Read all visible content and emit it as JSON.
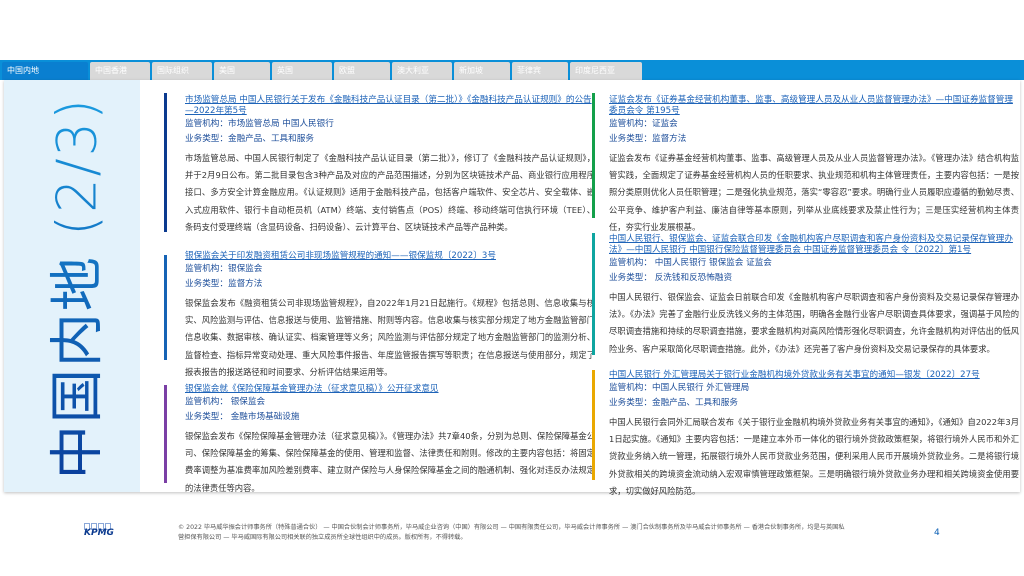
{
  "tabs": [
    "中国内地",
    "中国香港",
    "国际组织",
    "美国",
    "英国",
    "欧盟",
    "澳大利亚",
    "新加坡",
    "菲律宾",
    "印度尼西亚"
  ],
  "side_title": "中国内地 (2/3)",
  "colors": {
    "bar1": "#0b3a8f",
    "bar2": "#1563b5",
    "bar3": "#7a3fa5",
    "bar4": "#13a04a",
    "bar5": "#0ea5a0",
    "bar6": "#eaa800"
  },
  "items": [
    {
      "title": "市场监管总局 中国人民银行关于发布《金融科技产品认证目录（第二批）》《金融科技产品认证规则》的公告—2022年第5号",
      "agency": "监管机构：市场监管总局 中国人民银行",
      "type": "业务类型：金融产品、工具和服务",
      "body": "市场监管总局、中国人民银行制定了《金融科技产品认证目录（第二批）》，修订了《金融科技产品认证规则》，并于2月9日公布。第二批目录包含3种产品及对应的产品范围描述，分别为区块链技术产品、商业银行应用程序接口、多方安全计算金融应用。《认证规则》适用于金融科技产品，包括客户端软件、安全芯片、安全载体、嵌入式应用软件、银行卡自动柜员机（ATM）终端、支付销售点（POS）终端、移动终端可信执行环境（TEE）、条码支付受理终端（含显码设备、扫码设备）、云计算平台、区块链技术产品等产品种类。"
    },
    {
      "title": "银保监会关于印发融资租赁公司非现场监管规程的通知——银保监规〔2022〕3号",
      "agency": "监管机构：银保监会",
      "type": "业务类型：监督方法",
      "body": "银保监会发布《融资租赁公司非现场监管规程》，自2022年1月21日起施行。《规程》包括总则、信息收集与核实、风险监测与评估、信息报送与使用、监管措施、附则等内容。信息收集与核实部分规定了地方金融监管部门信息收集、数据审核、确认证实、档案管理等义务；风险监测与评估部分规定了地方金融监管部门的监测分析、监督检查、指标异常变动处理、重大风险事件报告、年度监管报告撰写等职责；在信息报送与使用部分，规定了报表报告的报送路径和时间要求、分析评估结果运用等。"
    },
    {
      "title": "银保监会就《保险保障基金管理办法（征求意见稿）》公开征求意见",
      "agency": "监管机构： 银保监会",
      "type": "业务类型： 金融市场基础设施",
      "body": "银保监会发布《保险保障基金管理办法（征求意见稿）》。《管理办法》共7章40条，分别为总则、保险保障基金公司、保险保障基金的筹集、保险保障基金的使用、管理和监督、法律责任和附则。修改的主要内容包括：将固定费率调整为基准费率加风险差别费率、建立财产保险与人身保险保障基金之间的融通机制、强化对违反办法规定的法律责任等内容。"
    },
    {
      "title": "证监会发布《证券基金经营机构董事、监事、高级管理人员及从业人员监督管理办法》—中国证券监督管理委员会令 第195号",
      "agency": "监管机构：证监会",
      "type": "业务类型：监督方法",
      "body": "证监会发布《证券基金经营机构董事、监事、高级管理人员及从业人员监督管理办法》。《管理办法》结合机构监管实践，全面规定了证券基金经营机构人员的任职要求、执业规范和机构主体管理责任，主要内容包括：一是按照分类原则优化人员任职管理；二是强化执业规范，落实“零容忍”要求。明确行业人员履职应遵循的勤勉尽责、公平竞争、维护客户利益、廉洁自律等基本原则，列举从业底线要求及禁止性行为；三是压实经营机构主体责任，夯实行业发展根基。"
    },
    {
      "title": "中国人民银行、银保监会、证监会联合印发《金融机构客户尽职调查和客户身份资料及交易记录保存管理办法》—中国人民银行 中国银行保险监督管理委员会 中国证券监督管理委员会 令〔2022〕第1号",
      "agency": "监管机构： 中国人民银行 银保监会 证监会",
      "type": "业务类型： 反洗钱和反恐怖融资",
      "body": "中国人民银行、银保监会、证监会日前联合印发《金融机构客户尽职调查和客户身份资料及交易记录保存管理办法》。《办法》完善了金融行业反洗钱义务的主体范围，明确各金融行业客户尽职调查具体要求，强调基于风险的尽职调查措施和持续的尽职调查措施，要求金融机构对高风险情形强化尽职调查，允许金融机构对评估出的低风险业务、客户采取简化尽职调查措施。此外，《办法》还完善了客户身份资料及交易记录保存的具体要求。"
    },
    {
      "title": "中国人民银行 外汇管理局关于银行业金融机构境外贷款业务有关事宜的通知—银发〔2022〕27号",
      "agency": "监管机构：中国人民银行 外汇管理局",
      "type": "业务类型：金融产品、工具和服务",
      "body": "中国人民银行会同外汇局联合发布《关于银行业金融机构境外贷款业务有关事宜的通知》，《通知》自2022年3月1日起实施。《通知》主要内容包括：一是建立本外币一体化的银行境外贷款政策框架，将银行境外人民币和外汇贷款业务纳入统一管理，拓展银行境外人民币贷款业务范围，便利采用人民币开展境外贷款业务。二是将银行境外贷款相关的跨境资金流动纳入宏观审慎管理政策框架。三是明确银行境外贷款业务办理和相关跨境资金使用要求，切实做好风险防范。"
    }
  ],
  "footer": {
    "text": "© 2022 毕马威华振会计师事务所（特殊普通合伙） — 中国合伙制会计师事务所，毕马威企业咨询（中国）有限公司 — 中国有限责任公司，毕马威会计师事务所 — 澳门合伙制事务所及毕马威会计师事务所 — 香港合伙制事务所，均是与英国私营担保有限公司 — 毕马威国际有限公司相关联的独立成员所全球性组织中的成员。版权所有，不得转载。",
    "page": "4",
    "logo": "KPMG"
  }
}
